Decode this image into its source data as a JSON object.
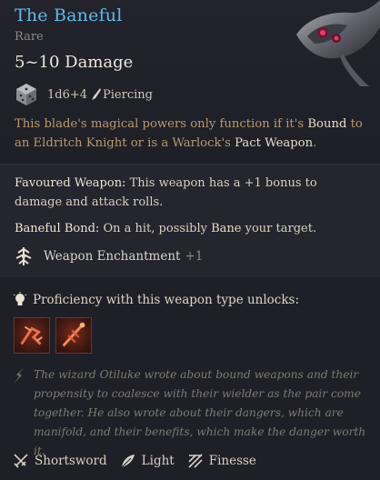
{
  "item": {
    "name": "The Baneful",
    "rarity": "Rare",
    "damage_range": "5~10 Damage",
    "damage_dice": "1d6+4",
    "damage_type": "Piercing",
    "description_pre": "This blade's magical powers only function if it's ",
    "description_kw1": "Bound",
    "description_mid": " to an Eldritch Knight or is a Warlock's ",
    "description_kw2": "Pact Weapon",
    "description_post": "."
  },
  "passives": [
    {
      "name": "Favoured Weapon:",
      "text": " This weapon has a +1 bonus to damage and attack rolls."
    },
    {
      "name": "Baneful Bond:",
      "text_pre": " On a hit, possibly ",
      "kw": "Bane",
      "text_post": " your target."
    }
  ],
  "enchantment": {
    "label": "Weapon Enchantment",
    "value": "+1"
  },
  "proficiency": {
    "label": "Proficiency with this weapon type unlocks:"
  },
  "flavor": "The wizard Otiluke wrote about bound weapons and their propensity to coalesce with their wielder as the pair come together. He also wrote about their dangers, which are manifold, and their benefits, which make the danger worth it.",
  "properties": [
    {
      "label": "Shortsword",
      "icon": "shortsword-icon"
    },
    {
      "label": "Light",
      "icon": "feather-icon"
    },
    {
      "label": "Finesse",
      "icon": "finesse-icon"
    }
  ],
  "colors": {
    "title": "#5fb9e8",
    "keyword": "#e6ddc8",
    "description": "#b89a6e",
    "flavor": "#7f7b73"
  }
}
